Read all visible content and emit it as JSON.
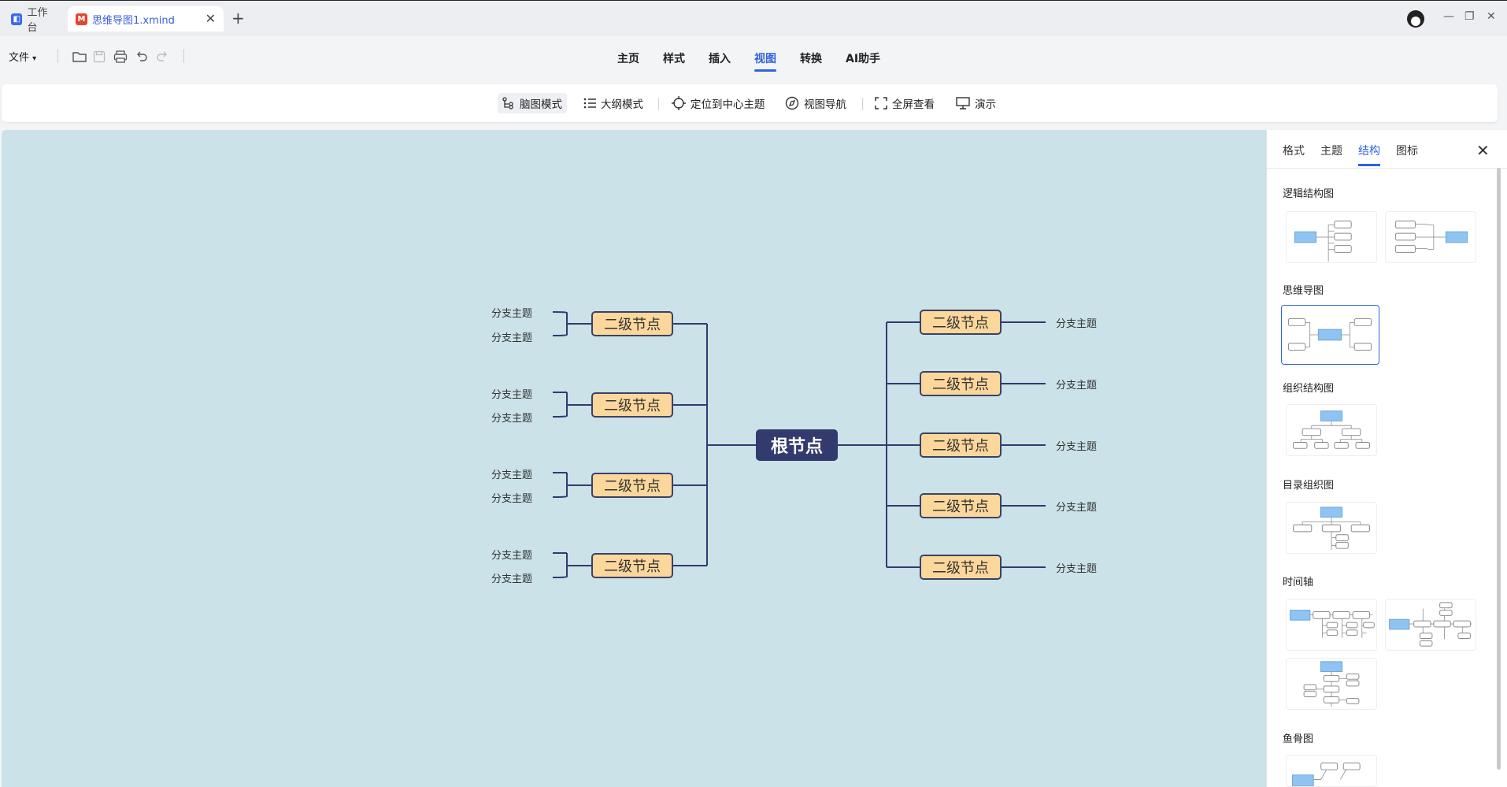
{
  "titlebar": {
    "tab_workspace": "工作台",
    "tab_file": "思维导图1.xmind",
    "new_tab": "+",
    "close_tab": "✕",
    "minimize": "—",
    "restore": "❐",
    "close_window": "✕"
  },
  "menubar": {
    "file_menu": "文件",
    "tabs": [
      "主页",
      "样式",
      "插入",
      "视图",
      "转换",
      "AI助手"
    ],
    "active_tab": "视图"
  },
  "ribbon": {
    "mindmap_mode": "脑图模式",
    "outline_mode": "大纲模式",
    "locate_center": "定位到中心主题",
    "view_nav": "视图导航",
    "fullscreen": "全屏查看",
    "present": "演示"
  },
  "mindmap": {
    "root": "根节点",
    "left_nodes": [
      {
        "label": "二级节点",
        "branches": [
          "分支主题",
          "分支主题"
        ]
      },
      {
        "label": "二级节点",
        "branches": [
          "分支主题",
          "分支主题"
        ]
      },
      {
        "label": "二级节点",
        "branches": [
          "分支主题",
          "分支主题"
        ]
      },
      {
        "label": "二级节点",
        "branches": [
          "分支主题",
          "分支主题"
        ]
      }
    ],
    "right_nodes": [
      {
        "label": "二级节点",
        "branch": "分支主题"
      },
      {
        "label": "二级节点",
        "branch": "分支主题"
      },
      {
        "label": "二级节点",
        "branch": "分支主题"
      },
      {
        "label": "二级节点",
        "branch": "分支主题"
      },
      {
        "label": "二级节点",
        "branch": "分支主题"
      }
    ],
    "colors": {
      "canvas": "#cae2e8",
      "node_fill": "#fcd79b",
      "line": "#333a6e",
      "root_fill": "#333a6e"
    }
  },
  "panel": {
    "tabs": [
      "格式",
      "主题",
      "结构",
      "图标"
    ],
    "active_tab": "结构",
    "close": "✕",
    "sections": {
      "logic": "逻辑结构图",
      "mindmap": "思维导图",
      "org": "组织结构图",
      "catalog": "目录组织图",
      "timeline": "时间轴",
      "fishbone": "鱼骨图"
    }
  }
}
